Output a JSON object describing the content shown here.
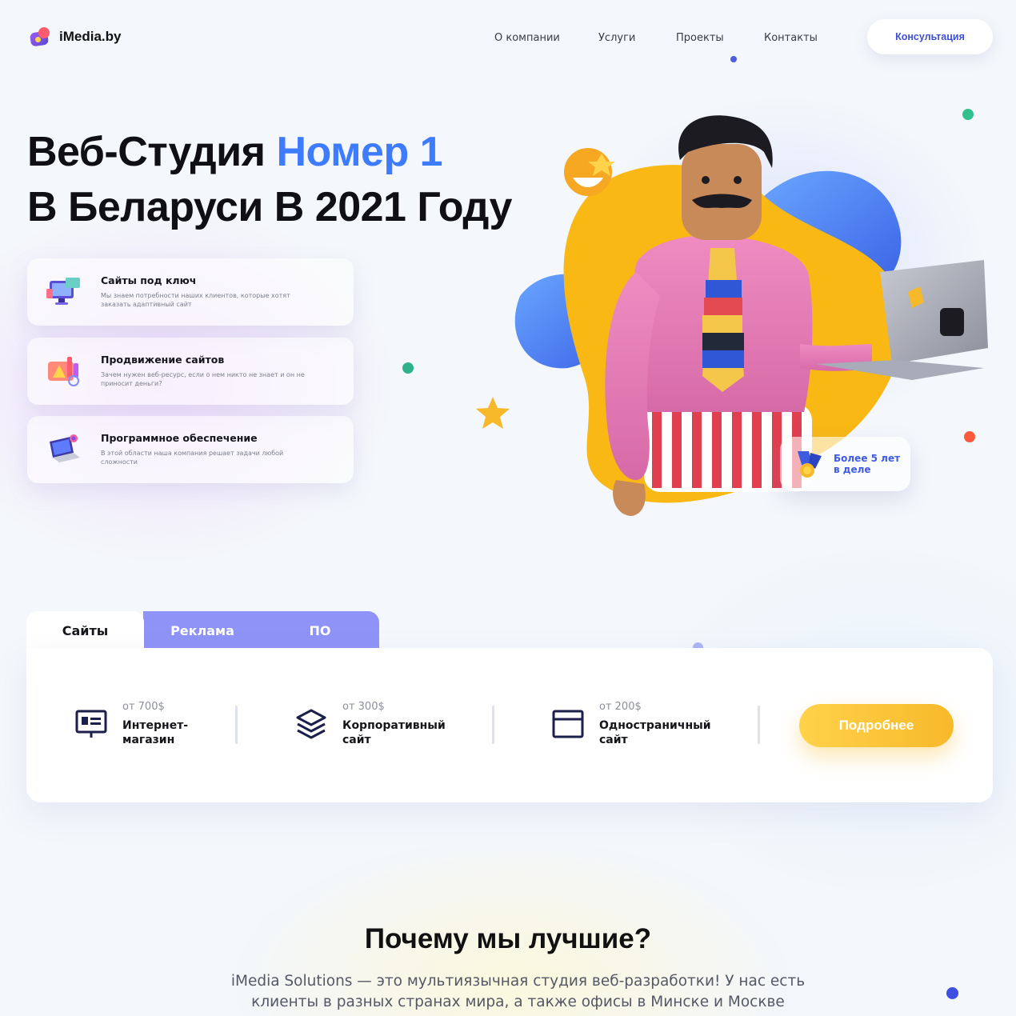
{
  "brand": {
    "name": "iMedia.by"
  },
  "nav": {
    "items": [
      {
        "label": "О компании"
      },
      {
        "label": "Услуги"
      },
      {
        "label": "Проекты"
      },
      {
        "label": "Контакты"
      }
    ],
    "cta_label": "Консультация"
  },
  "hero": {
    "title_part1": "Веб-Студия ",
    "title_accent": "Номер 1",
    "title_line2": "В Беларуси В 2021 Году",
    "accent_color": "#3d7bff"
  },
  "features": [
    {
      "title": "Сайты под ключ",
      "desc": "Мы знаем потребности наших клиентов, которые хотят заказать адаптивный сайт",
      "icon": "monitor-icon"
    },
    {
      "title": "Продвижение сайтов",
      "desc": "Зачем нужен веб-ресурс, если о нем никто не знает и он не приносит деньги?",
      "icon": "chart-icon"
    },
    {
      "title": "Программное обеспечение",
      "desc": "В этой области наша компания решает задачи любой сложности",
      "icon": "laptop-icon"
    }
  ],
  "badge": {
    "text": "Более 5 лет в деле",
    "icon": "medal-icon"
  },
  "tabs": [
    {
      "label": "Сайты",
      "active": true
    },
    {
      "label": "Реклама",
      "active": false
    },
    {
      "label": "ПО",
      "active": false
    }
  ],
  "services": [
    {
      "price": "от 700$",
      "name": "Интернет-магазин",
      "icon": "presentation-icon"
    },
    {
      "price": "от 300$",
      "name": "Корпоративный сайт",
      "icon": "layers-icon"
    },
    {
      "price": "от 200$",
      "name": "Одностраничный сайт",
      "icon": "browser-window-icon"
    }
  ],
  "more_button": {
    "label": "Подробнее"
  },
  "why": {
    "title": "Почему мы лучшие?",
    "text": "iMedia Solutions — это мультиязычная студия веб-разработки! У нас есть клиенты в разных странах мира, а также офисы в Минске и Москве"
  },
  "colors": {
    "accent_blue": "#3d7bff",
    "tab_purple": "#8f93f7",
    "button_yellow": "#f7b92a",
    "cta_blue": "#3d4fd6"
  }
}
